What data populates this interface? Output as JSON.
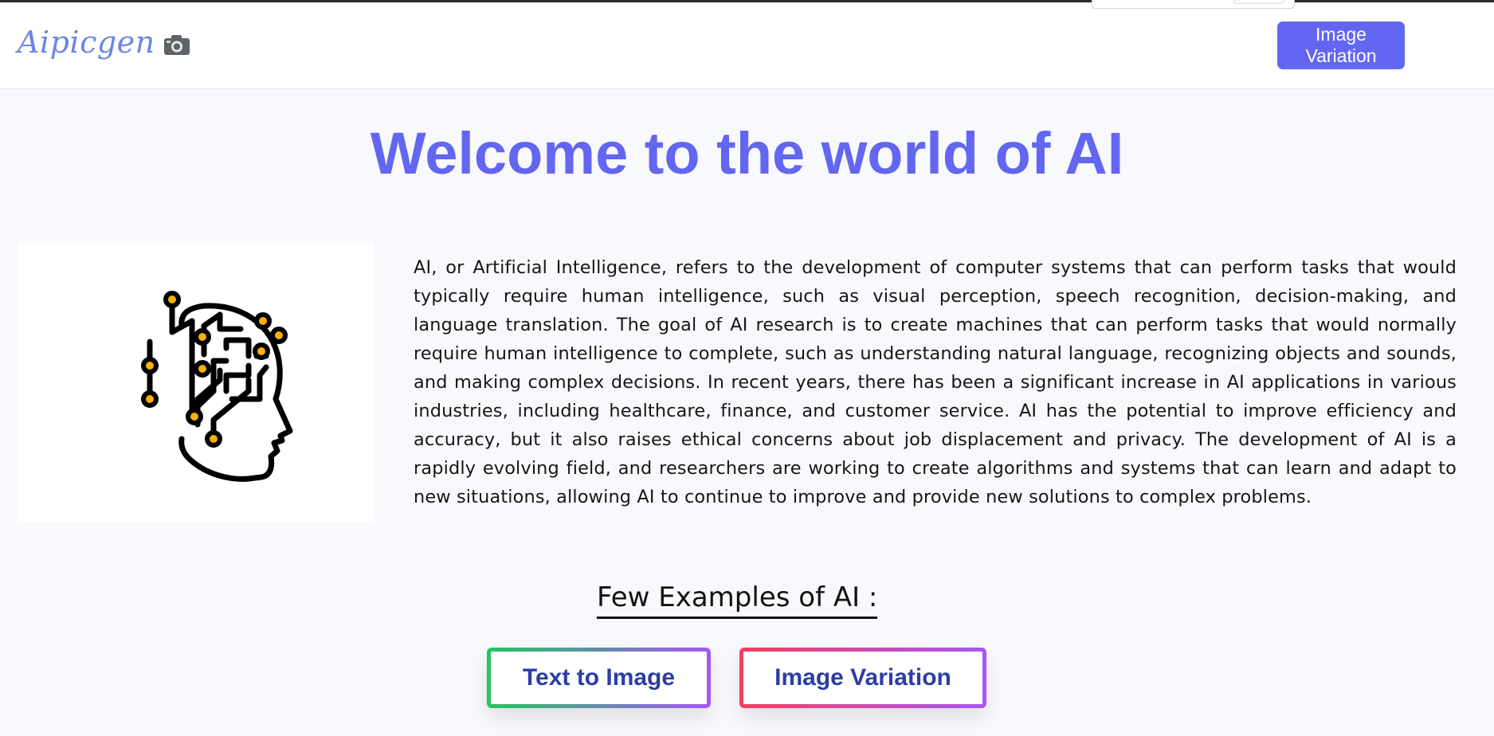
{
  "colors": {
    "accent": "#6366f1",
    "brand": "#6a86e6",
    "node_fill": "#f5b100",
    "example_text": "#2b3ea3"
  },
  "header": {
    "brand": "Aipicgen",
    "brand_icon": "camera-icon",
    "nav_button": "Image Variation"
  },
  "main": {
    "title": "Welcome to the world of AI",
    "image_icon": "ai-circuit-head-icon",
    "description": "AI, or Artificial Intelligence, refers to the development of computer systems that can perform tasks that would typically require human intelligence, such as visual perception, speech recognition, decision-making, and language translation. The goal of AI research is to create machines that can perform tasks that would normally require human intelligence to complete, such as understanding natural language, recognizing objects and sounds, and making complex decisions. In recent years, there has been a significant increase in AI applications in various industries, including healthcare, finance, and customer service. AI has the potential to improve efficiency and accuracy, but it also raises ethical concerns about job displacement and privacy. The development of AI is a rapidly evolving field, and researchers are working to create algorithms and systems that can learn and adapt to new situations, allowing AI to continue to improve and provide new solutions to complex problems."
  },
  "examples": {
    "title": "Few Examples of AI :",
    "buttons": [
      "Text to Image",
      "Image Variation"
    ]
  }
}
